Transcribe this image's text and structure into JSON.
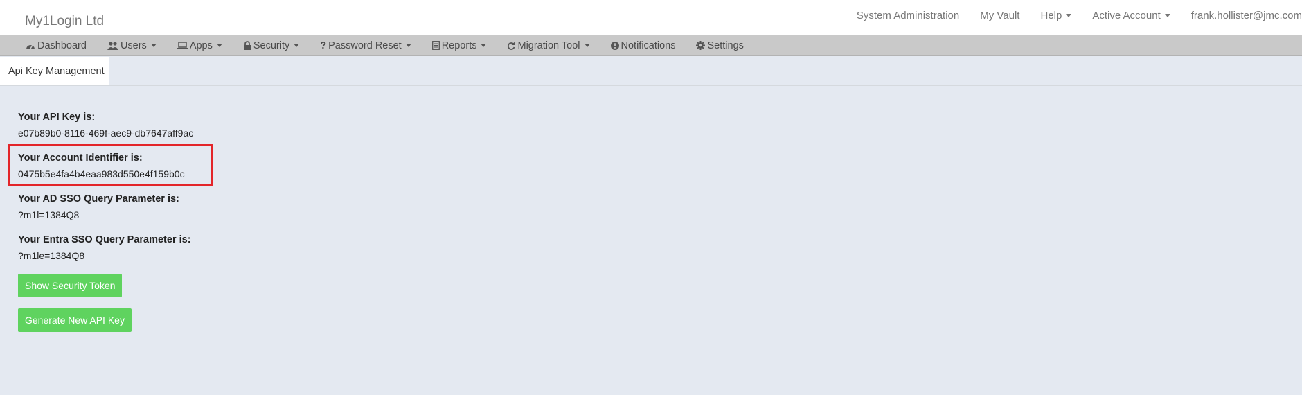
{
  "header": {
    "brand": "My1Login Ltd",
    "nav": [
      {
        "label": "System Administration"
      },
      {
        "label": "My Vault"
      },
      {
        "label": "Help",
        "dropdown": true
      },
      {
        "label": "Active Account",
        "dropdown": true
      },
      {
        "label": "frank.hollister@jmc.com"
      }
    ]
  },
  "menu": {
    "items": [
      {
        "label": "Dashboard",
        "icon": "dashboard-icon"
      },
      {
        "label": "Users",
        "icon": "users-icon",
        "dropdown": true
      },
      {
        "label": "Apps",
        "icon": "laptop-icon",
        "dropdown": true
      },
      {
        "label": "Security",
        "icon": "lock-icon",
        "dropdown": true
      },
      {
        "label": "Password Reset",
        "icon": "question-icon",
        "dropdown": true
      },
      {
        "label": "Reports",
        "icon": "report-icon",
        "dropdown": true
      },
      {
        "label": "Migration Tool",
        "icon": "refresh-icon",
        "dropdown": true
      },
      {
        "label": "Notifications",
        "icon": "info-circle-icon"
      },
      {
        "label": "Settings",
        "icon": "gear-icon"
      }
    ]
  },
  "tabs": [
    {
      "label": "Api Key Management",
      "active": true
    }
  ],
  "fields": [
    {
      "label": "Your API Key is:",
      "value": "e07b89b0-8116-469f-aec9-db7647aff9ac"
    },
    {
      "label": "Your Account Identifier is:",
      "value": "0475b5e4fa4b4eaa983d550e4f159b0c",
      "highlighted": true
    },
    {
      "label": "Your AD SSO Query Parameter is:",
      "value": "?m1l=1384Q8"
    },
    {
      "label": "Your Entra SSO Query Parameter is:",
      "value": "?m1le=1384Q8"
    }
  ],
  "buttons": {
    "show_token": "Show Security Token",
    "generate_key": "Generate New API Key"
  },
  "colors": {
    "button_green": "#5fd35f",
    "highlight_red": "#e3252a",
    "page_bg": "#e4e9f1",
    "menubar_bg": "#c9c9c9"
  }
}
